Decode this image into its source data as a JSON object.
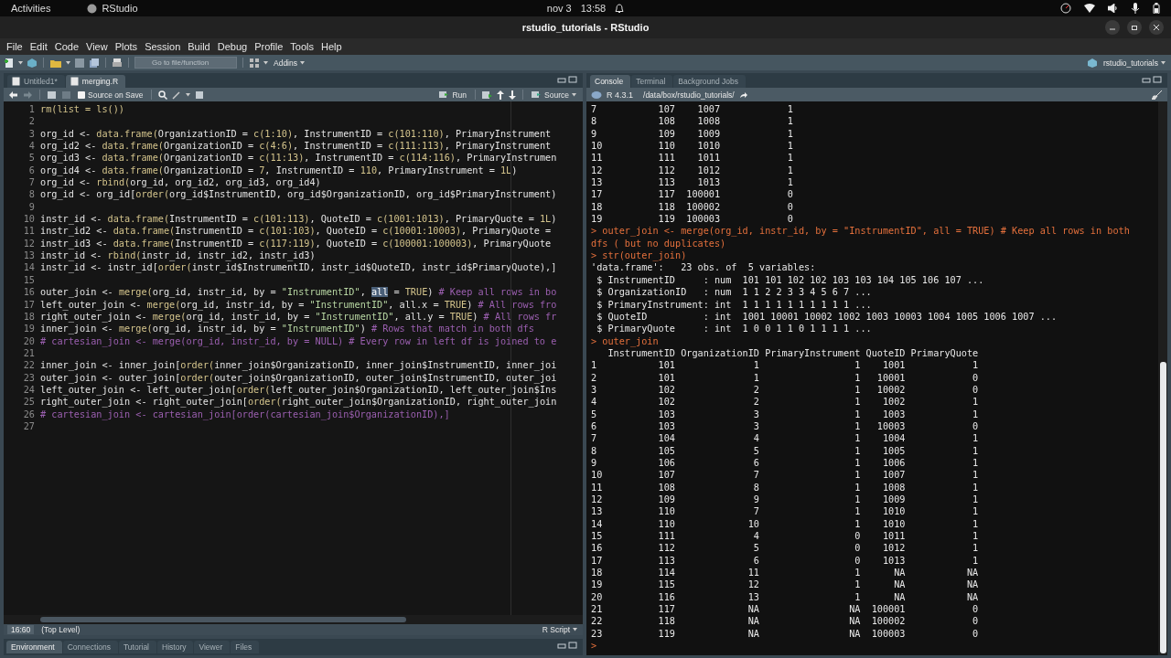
{
  "topbar": {
    "activities": "Activities",
    "app": "RStudio",
    "date": "nov 3",
    "time": "13:58"
  },
  "window": {
    "title": "rstudio_tutorials - RStudio"
  },
  "menu": [
    "File",
    "Edit",
    "Code",
    "View",
    "Plots",
    "Session",
    "Build",
    "Debug",
    "Profile",
    "Tools",
    "Help"
  ],
  "toolbar": {
    "goto_placeholder": "Go to file/function",
    "addins": "Addins",
    "project": "rstudio_tutorials"
  },
  "editor": {
    "tabs": [
      {
        "label": "Untitled1*",
        "selected": false
      },
      {
        "label": "merging.R",
        "selected": true
      }
    ],
    "source_on_save": {
      "label": "Source on Save",
      "checked": false
    },
    "run": "Run",
    "source": "Source",
    "lines": [
      {
        "number": "1",
        "segments": [
          {
            "kind": "fn",
            "text": "rm(list = ls())"
          }
        ]
      },
      {
        "number": "2"
      },
      {
        "number": "3",
        "segments": [
          {
            "kind": "plain",
            "text": "org_id <- "
          },
          {
            "kind": "fn",
            "text": "data.frame("
          },
          {
            "kind": "plain",
            "text": "OrganizationID = "
          },
          {
            "kind": "fn",
            "text": "c(1:10)"
          },
          {
            "kind": "plain",
            "text": ", InstrumentID = "
          },
          {
            "kind": "fn",
            "text": "c(101:110)"
          },
          {
            "kind": "plain",
            "text": ", PrimaryInstrument"
          }
        ]
      },
      {
        "number": "4",
        "segments": [
          {
            "kind": "plain",
            "text": "org_id2 <- "
          },
          {
            "kind": "fn",
            "text": "data.frame("
          },
          {
            "kind": "plain",
            "text": "OrganizationID = "
          },
          {
            "kind": "fn",
            "text": "c(4:6)"
          },
          {
            "kind": "plain",
            "text": ", InstrumentID = "
          },
          {
            "kind": "fn",
            "text": "c(111:113)"
          },
          {
            "kind": "plain",
            "text": ", PrimaryInstrument"
          }
        ]
      },
      {
        "number": "5",
        "segments": [
          {
            "kind": "plain",
            "text": "org_id3 <- "
          },
          {
            "kind": "fn",
            "text": "data.frame("
          },
          {
            "kind": "plain",
            "text": "OrganizationID = "
          },
          {
            "kind": "fn",
            "text": "c(11:13)"
          },
          {
            "kind": "plain",
            "text": ", InstrumentID = "
          },
          {
            "kind": "fn",
            "text": "c(114:116)"
          },
          {
            "kind": "plain",
            "text": ", PrimaryInstrumen"
          }
        ]
      },
      {
        "number": "6",
        "segments": [
          {
            "kind": "plain",
            "text": "org_id4 <- "
          },
          {
            "kind": "fn",
            "text": "data.frame("
          },
          {
            "kind": "plain",
            "text": "OrganizationID = "
          },
          {
            "kind": "const",
            "text": "7"
          },
          {
            "kind": "plain",
            "text": ", InstrumentID = "
          },
          {
            "kind": "const",
            "text": "110"
          },
          {
            "kind": "plain",
            "text": ", PrimaryInstrument = "
          },
          {
            "kind": "const",
            "text": "1L"
          },
          {
            "kind": "plain",
            "text": ")"
          }
        ]
      },
      {
        "number": "7",
        "segments": [
          {
            "kind": "plain",
            "text": "org_id <- "
          },
          {
            "kind": "fn",
            "text": "rbind("
          },
          {
            "kind": "plain",
            "text": "org_id, org_id2, org_id3, org_id4)"
          }
        ]
      },
      {
        "number": "8",
        "segments": [
          {
            "kind": "plain",
            "text": "org_id <- org_id["
          },
          {
            "kind": "fn",
            "text": "order("
          },
          {
            "kind": "plain",
            "text": "org_id$InstrumentID, org_id$OrganizationID, org_id$PrimaryInstrument)"
          }
        ]
      },
      {
        "number": "9"
      },
      {
        "number": "10",
        "segments": [
          {
            "kind": "plain",
            "text": "instr_id <- "
          },
          {
            "kind": "fn",
            "text": "data.frame("
          },
          {
            "kind": "plain",
            "text": "InstrumentID = "
          },
          {
            "kind": "fn",
            "text": "c(101:113)"
          },
          {
            "kind": "plain",
            "text": ", QuoteID = "
          },
          {
            "kind": "fn",
            "text": "c(1001:1013)"
          },
          {
            "kind": "plain",
            "text": ", PrimaryQuote = "
          },
          {
            "kind": "const",
            "text": "1L"
          },
          {
            "kind": "plain",
            "text": ")"
          }
        ]
      },
      {
        "number": "11",
        "segments": [
          {
            "kind": "plain",
            "text": "instr_id2 <- "
          },
          {
            "kind": "fn",
            "text": "data.frame("
          },
          {
            "kind": "plain",
            "text": "InstrumentID = "
          },
          {
            "kind": "fn",
            "text": "c(101:103)"
          },
          {
            "kind": "plain",
            "text": ", QuoteID = "
          },
          {
            "kind": "fn",
            "text": "c(10001:10003)"
          },
          {
            "kind": "plain",
            "text": ", PrimaryQuote ="
          }
        ]
      },
      {
        "number": "12",
        "segments": [
          {
            "kind": "plain",
            "text": "instr_id3 <- "
          },
          {
            "kind": "fn",
            "text": "data.frame("
          },
          {
            "kind": "plain",
            "text": "InstrumentID = "
          },
          {
            "kind": "fn",
            "text": "c(117:119)"
          },
          {
            "kind": "plain",
            "text": ", QuoteID = "
          },
          {
            "kind": "fn",
            "text": "c(100001:100003)"
          },
          {
            "kind": "plain",
            "text": ", PrimaryQuote"
          }
        ]
      },
      {
        "number": "13",
        "segments": [
          {
            "kind": "plain",
            "text": "instr_id <- "
          },
          {
            "kind": "fn",
            "text": "rbind("
          },
          {
            "kind": "plain",
            "text": "instr_id, instr_id2, instr_id3)"
          }
        ]
      },
      {
        "number": "14",
        "segments": [
          {
            "kind": "plain",
            "text": "instr_id <- instr_id["
          },
          {
            "kind": "fn",
            "text": "order("
          },
          {
            "kind": "plain",
            "text": "instr_id$InstrumentID, instr_id$QuoteID, instr_id$PrimaryQuote),]"
          }
        ]
      },
      {
        "number": "15"
      },
      {
        "number": "16",
        "segments": [
          {
            "kind": "plain",
            "text": "outer_join <- "
          },
          {
            "kind": "fn",
            "text": "merge("
          },
          {
            "kind": "plain",
            "text": "org_id, instr_id, by = "
          },
          {
            "kind": "str",
            "text": "\"InstrumentID\""
          },
          {
            "kind": "plain",
            "text": ", "
          },
          {
            "kind": "selected",
            "text": "all"
          },
          {
            "kind": "plain",
            "text": " = "
          },
          {
            "kind": "const",
            "text": "TRUE"
          },
          {
            "kind": "plain",
            "text": ") "
          },
          {
            "kind": "comment",
            "text": "# Keep all rows in bo"
          }
        ]
      },
      {
        "number": "17",
        "segments": [
          {
            "kind": "plain",
            "text": "left_outer_join <- "
          },
          {
            "kind": "fn",
            "text": "merge("
          },
          {
            "kind": "plain",
            "text": "org_id, instr_id, by = "
          },
          {
            "kind": "str",
            "text": "\"InstrumentID\""
          },
          {
            "kind": "plain",
            "text": ", all.x = "
          },
          {
            "kind": "const",
            "text": "TRUE"
          },
          {
            "kind": "plain",
            "text": ") "
          },
          {
            "kind": "comment",
            "text": "# All rows fro"
          }
        ]
      },
      {
        "number": "18",
        "segments": [
          {
            "kind": "plain",
            "text": "right_outer_join <- "
          },
          {
            "kind": "fn",
            "text": "merge("
          },
          {
            "kind": "plain",
            "text": "org_id, instr_id, by = "
          },
          {
            "kind": "str",
            "text": "\"InstrumentID\""
          },
          {
            "kind": "plain",
            "text": ", all.y = "
          },
          {
            "kind": "const",
            "text": "TRUE"
          },
          {
            "kind": "plain",
            "text": ") "
          },
          {
            "kind": "comment",
            "text": "# All rows fr"
          }
        ]
      },
      {
        "number": "19",
        "segments": [
          {
            "kind": "plain",
            "text": "inner_join <- "
          },
          {
            "kind": "fn",
            "text": "merge("
          },
          {
            "kind": "plain",
            "text": "org_id, instr_id, by = "
          },
          {
            "kind": "str",
            "text": "\"InstrumentID\""
          },
          {
            "kind": "plain",
            "text": ") "
          },
          {
            "kind": "comment",
            "text": "# Rows that match in both dfs"
          }
        ]
      },
      {
        "number": "20",
        "segments": [
          {
            "kind": "comment",
            "text": "# cartesian_join <- merge(org_id, instr_id, by = NULL) # Every row in left df is joined to e"
          }
        ]
      },
      {
        "number": "21"
      },
      {
        "number": "22",
        "segments": [
          {
            "kind": "plain",
            "text": "inner_join <- inner_join["
          },
          {
            "kind": "fn",
            "text": "order("
          },
          {
            "kind": "plain",
            "text": "inner_join$OrganizationID, inner_join$InstrumentID, inner_joi"
          }
        ]
      },
      {
        "number": "23",
        "segments": [
          {
            "kind": "plain",
            "text": "outer_join <- outer_join["
          },
          {
            "kind": "fn",
            "text": "order("
          },
          {
            "kind": "plain",
            "text": "outer_join$OrganizationID, outer_join$InstrumentID, outer_joi"
          }
        ]
      },
      {
        "number": "24",
        "segments": [
          {
            "kind": "plain",
            "text": "left_outer_join <- left_outer_join["
          },
          {
            "kind": "fn",
            "text": "order("
          },
          {
            "kind": "plain",
            "text": "left_outer_join$OrganizationID, left_outer_join$Ins"
          }
        ]
      },
      {
        "number": "25",
        "segments": [
          {
            "kind": "plain",
            "text": "right_outer_join <- right_outer_join["
          },
          {
            "kind": "fn",
            "text": "order("
          },
          {
            "kind": "plain",
            "text": "right_outer_join$OrganizationID, right_outer_join"
          }
        ]
      },
      {
        "number": "26",
        "segments": [
          {
            "kind": "comment",
            "text": "# cartesian_join <- cartesian_join[order(cartesian_join$OrganizationID),]"
          }
        ]
      },
      {
        "number": "27"
      }
    ],
    "status": {
      "position": "16:60",
      "scope": "(Top Level)",
      "filetype": "R Script"
    }
  },
  "bottom_tabs": [
    {
      "label": "Environment",
      "selected": true
    },
    {
      "label": "Connections",
      "selected": false
    },
    {
      "label": "Tutorial",
      "selected": false
    },
    {
      "label": "History",
      "selected": false
    },
    {
      "label": "Viewer",
      "selected": false
    },
    {
      "label": "Files",
      "selected": false
    }
  ],
  "console": {
    "tabs": [
      {
        "label": "Console",
        "selected": true
      },
      {
        "label": "Terminal",
        "selected": false
      },
      {
        "label": "Background Jobs",
        "selected": false
      }
    ],
    "version": "R 4.3.1",
    "path": "/data/box/rstudio_tutorials/",
    "entries": [
      {
        "kind": "output",
        "text": "7           107    1007            1"
      },
      {
        "kind": "output",
        "text": "8           108    1008            1"
      },
      {
        "kind": "output",
        "text": "9           109    1009            1"
      },
      {
        "kind": "output",
        "text": "10          110    1010            1"
      },
      {
        "kind": "output",
        "text": "11          111    1011            1"
      },
      {
        "kind": "output",
        "text": "12          112    1012            1"
      },
      {
        "kind": "output",
        "text": "13          113    1013            1"
      },
      {
        "kind": "output",
        "text": "17          117  100001            0"
      },
      {
        "kind": "output",
        "text": "18          118  100002            0"
      },
      {
        "kind": "output",
        "text": "19          119  100003            0"
      },
      {
        "kind": "command",
        "text": "> outer_join <- merge(org_id, instr_id, by = \"InstrumentID\", all = TRUE) # Keep all rows in both"
      },
      {
        "kind": "command",
        "text": "dfs ( but no duplicates)"
      },
      {
        "kind": "command",
        "text": "> str(outer_join)"
      },
      {
        "kind": "output",
        "text": "'data.frame':   23 obs. of  5 variables:"
      },
      {
        "kind": "output",
        "text": " $ InstrumentID     : num  101 101 102 102 103 103 104 105 106 107 ..."
      },
      {
        "kind": "output",
        "text": " $ OrganizationID   : num  1 1 2 2 3 3 4 5 6 7 ..."
      },
      {
        "kind": "output",
        "text": " $ PrimaryInstrument: int  1 1 1 1 1 1 1 1 1 1 ..."
      },
      {
        "kind": "output",
        "text": " $ QuoteID          : int  1001 10001 10002 1002 1003 10003 1004 1005 1006 1007 ..."
      },
      {
        "kind": "output",
        "text": " $ PrimaryQuote     : int  1 0 0 1 1 0 1 1 1 1 ..."
      },
      {
        "kind": "command",
        "text": "> outer_join"
      },
      {
        "kind": "table",
        "columns": [
          "InstrumentID",
          "OrganizationID",
          "PrimaryInstrument",
          "QuoteID",
          "PrimaryQuote"
        ],
        "rows": [
          {
            "label": "1",
            "cells": [
              "101",
              "1",
              "1",
              "1001",
              "1"
            ]
          },
          {
            "label": "2",
            "cells": [
              "101",
              "1",
              "1",
              "10001",
              "0"
            ]
          },
          {
            "label": "3",
            "cells": [
              "102",
              "2",
              "1",
              "10002",
              "0"
            ]
          },
          {
            "label": "4",
            "cells": [
              "102",
              "2",
              "1",
              "1002",
              "1"
            ]
          },
          {
            "label": "5",
            "cells": [
              "103",
              "3",
              "1",
              "1003",
              "1"
            ]
          },
          {
            "label": "6",
            "cells": [
              "103",
              "3",
              "1",
              "10003",
              "0"
            ]
          },
          {
            "label": "7",
            "cells": [
              "104",
              "4",
              "1",
              "1004",
              "1"
            ]
          },
          {
            "label": "8",
            "cells": [
              "105",
              "5",
              "1",
              "1005",
              "1"
            ]
          },
          {
            "label": "9",
            "cells": [
              "106",
              "6",
              "1",
              "1006",
              "1"
            ]
          },
          {
            "label": "10",
            "cells": [
              "107",
              "7",
              "1",
              "1007",
              "1"
            ]
          },
          {
            "label": "11",
            "cells": [
              "108",
              "8",
              "1",
              "1008",
              "1"
            ]
          },
          {
            "label": "12",
            "cells": [
              "109",
              "9",
              "1",
              "1009",
              "1"
            ]
          },
          {
            "label": "13",
            "cells": [
              "110",
              "7",
              "1",
              "1010",
              "1"
            ]
          },
          {
            "label": "14",
            "cells": [
              "110",
              "10",
              "1",
              "1010",
              "1"
            ]
          },
          {
            "label": "15",
            "cells": [
              "111",
              "4",
              "0",
              "1011",
              "1"
            ]
          },
          {
            "label": "16",
            "cells": [
              "112",
              "5",
              "0",
              "1012",
              "1"
            ]
          },
          {
            "label": "17",
            "cells": [
              "113",
              "6",
              "0",
              "1013",
              "1"
            ]
          },
          {
            "label": "18",
            "cells": [
              "114",
              "11",
              "1",
              "NA",
              "NA"
            ]
          },
          {
            "label": "19",
            "cells": [
              "115",
              "12",
              "1",
              "NA",
              "NA"
            ]
          },
          {
            "label": "20",
            "cells": [
              "116",
              "13",
              "1",
              "NA",
              "NA"
            ]
          },
          {
            "label": "21",
            "cells": [
              "117",
              "NA",
              "NA",
              "100001",
              "0"
            ]
          },
          {
            "label": "22",
            "cells": [
              "118",
              "NA",
              "NA",
              "100002",
              "0"
            ]
          },
          {
            "label": "23",
            "cells": [
              "119",
              "NA",
              "NA",
              "100003",
              "0"
            ]
          }
        ]
      },
      {
        "kind": "prompt",
        "text": ">"
      }
    ]
  }
}
